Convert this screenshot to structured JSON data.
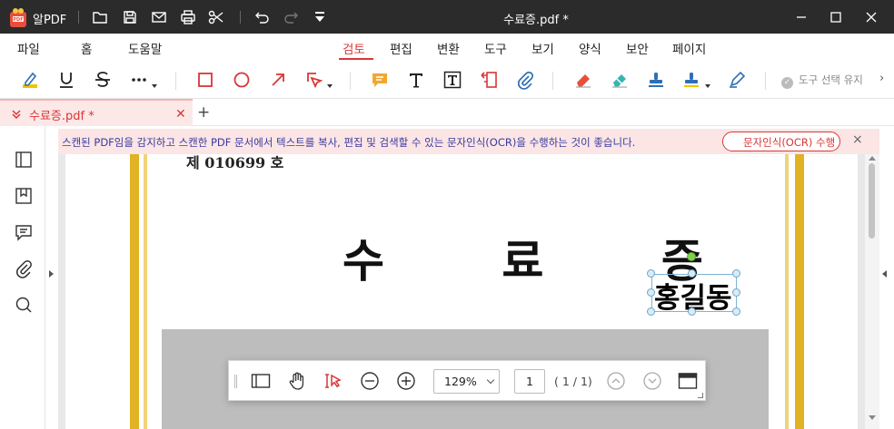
{
  "app": {
    "name": "알PDF",
    "window_title": "수료증.pdf *"
  },
  "titlebar": {
    "quick_icons": [
      "folder-open-icon",
      "save-icon",
      "mail-icon",
      "print-icon",
      "scissors-icon",
      "undo-icon",
      "redo-icon",
      "customize-icon"
    ],
    "window_controls": [
      "minimize-icon",
      "maximize-icon",
      "close-icon"
    ]
  },
  "menu": {
    "left": [
      "파일",
      "홈",
      "도움말"
    ],
    "tabs": [
      "검토",
      "편집",
      "변환",
      "도구",
      "보기",
      "양식",
      "보안",
      "페이지"
    ],
    "active": "검토"
  },
  "toolbar": {
    "select_hold_label": "도구 선택 유지",
    "icons": [
      "highlight-icon",
      "underline-icon",
      "strikethrough-icon",
      "more-text-markup-icon",
      "rectangle-icon",
      "ellipse-icon",
      "arrow-icon",
      "shapes-icon",
      "note-icon",
      "text-icon",
      "textbox-icon",
      "callout-icon",
      "attachment-icon",
      "eraser-icon",
      "eraser-alt-icon",
      "stamp-icon",
      "stamp-color-icon",
      "pen-icon"
    ],
    "colors": {
      "accent": "#d93636",
      "icon_blue": "#2f6fb5",
      "icon_orange": "#f0a830",
      "icon_teal": "#35b5b5"
    }
  },
  "doc_tab": {
    "name": "수료증.pdf *",
    "new_tab_label": "+"
  },
  "sidebar": {
    "icons": [
      "panel-icon",
      "bookmark-icon",
      "comment-icon",
      "attachment-icon",
      "search-icon"
    ]
  },
  "ocr_banner": {
    "message": "스캔된 PDF임을 감지하고 스캔한 PDF 문서에서 텍스트를 복사, 편집 및 검색할 수 있는 문자인식(OCR)을 수행하는 것이 좋습니다.",
    "button_label": "문자인식(OCR) 수행",
    "close_label": "×"
  },
  "document": {
    "cert_number": "제 010699 호",
    "title": "수 료 증",
    "signature": "홍길동"
  },
  "float_bar": {
    "zoom": "129%",
    "page_current": "1",
    "page_total": "( 1 / 1)"
  }
}
